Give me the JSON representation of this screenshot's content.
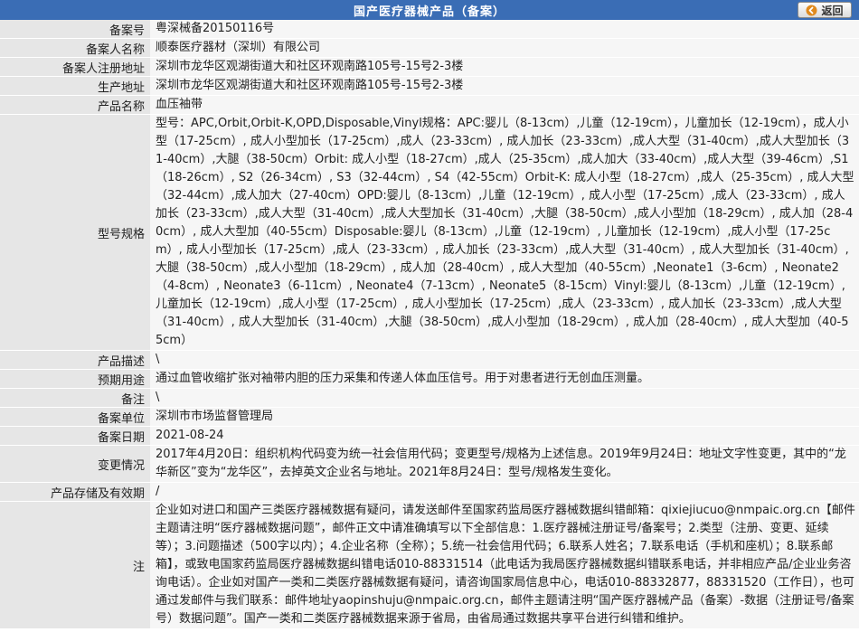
{
  "header": {
    "title": "国产医疗器械产品（备案）",
    "back_label": "返回"
  },
  "rows": [
    {
      "label": "备案号",
      "value": "粤深械备20150116号"
    },
    {
      "label": "备案人名称",
      "value": "顺泰医疗器材（深圳）有限公司"
    },
    {
      "label": "备案人注册地址",
      "value": "深圳市龙华区观湖街道大和社区环观南路105号-15号2-3楼"
    },
    {
      "label": "生产地址",
      "value": "深圳市龙华区观湖街道大和社区环观南路105号-15号2-3楼"
    },
    {
      "label": "产品名称",
      "value": "血压袖带"
    },
    {
      "label": "型号规格",
      "value": "型号：APC,Orbit,Orbit-K,OPD,Disposable,Vinyl规格：APC:婴儿（8-13cm）,儿童（12-19cm），儿童加长（12-19cm），成人小型（17-25cm）, 成人小型加长（17-25cm）,成人（23-33cm）, 成人加长（23-33cm）,成人大型（31-40cm）,成人大型加长（31-40cm）,大腿（38-50cm）Orbit: 成人小型（18-27cm）,成人（25-35cm）,成人加大（33-40cm）,成人大型（39-46cm）,S1（18-26cm）, S2（26-34cm）, S3（32-44cm）, S4（42-55cm）Orbit-K: 成人小型（18-27cm）,成人（25-35cm）, 成人大型（32-44cm）,成人加大（27-40cm）OPD:婴儿（8-13cm）,儿童（12-19cm）, 成人小型（17-25cm）,成人（23-33cm）, 成人加长（23-33cm）,成人大型（31-40cm）,成人大型加长（31-40cm）,大腿（38-50cm）,成人小型加（18-29cm）, 成人加（28-40cm）, 成人大型加（40-55cm）Disposable:婴儿（8-13cm）,儿童（12-19cm）, 儿童加长（12-19cm）,成人小型（17-25cm）, 成人小型加长（17-25cm）,成人（23-33cm）, 成人加长（23-33cm）,成人大型（31-40cm）, 成人大型加长（31-40cm）,大腿（38-50cm）,成人小型加（18-29cm）, 成人加（28-40cm）, 成人大型加（40-55cm）,Neonate1（3-6cm）, Neonate2（4-8cm）, Neonate3（6-11cm）, Neonate4（7-13cm）, Neonate5（8-15cm）Vinyl:婴儿（8-13cm）,儿童（12-19cm）, 儿童加长（12-19cm）,成人小型（17-25cm）, 成人小型加长（17-25cm）,成人（23-33cm）, 成人加长（23-33cm）,成人大型（31-40cm）, 成人大型加长（31-40cm）,大腿（38-50cm）,成人小型加（18-29cm）, 成人加（28-40cm）, 成人大型加（40-55cm）"
    },
    {
      "label": "产品描述",
      "value": "\\"
    },
    {
      "label": "预期用途",
      "value": "通过血管收缩扩张对袖带内胆的压力采集和传递人体血压信号。用于对患者进行无创血压测量。"
    },
    {
      "label": "备注",
      "value": "\\"
    },
    {
      "label": "备案单位",
      "value": "深圳市市场监督管理局"
    },
    {
      "label": "备案日期",
      "value": "2021-08-24"
    },
    {
      "label": "变更情况",
      "value": "2017年4月20日：组织机构代码变为统一社会信用代码；变更型号/规格为上述信息。2019年9月24日：地址文字性变更，其中的“龙华新区”变为“龙华区”，去掉英文企业名与地址。2021年8月24日：型号/规格发生变化。"
    },
    {
      "label": "产品存储及有效期",
      "value": "/"
    },
    {
      "label": "注",
      "value": "企业如对进口和国产三类医疗器械数据有疑问，请发送邮件至国家药监局医疗器械数据纠错邮箱：qixiejiucuo@nmpaic.org.cn【邮件主题请注明“医疗器械数据问题”，邮件正文中请准确填写以下全部信息：1.医疗器械注册证号/备案号；2.类型（注册、变更、延续等）；3.问题描述（500字以内）；4.企业名称（全称）；5.统一社会信用代码；6.联系人姓名；7.联系电话（手机和座机）；8.联系邮箱】，或致电国家药监局医疗器械数据纠错电话010-88331514（此电话为我局医疗器械数据纠错联系电话，并非相应产品/企业业务咨询电话）。企业如对国产一类和二类医疗器械数据有疑问，请咨询国家局信息中心，电话010-88332877，88331520（工作日），也可通过发邮件与我们联系：邮件地址yaopinshuju@nmpaic.org.cn，邮件主题请注明“国产医疗器械产品（备案）-数据（注册证号/备案号）数据问题”。国产一类和二类医疗器械数据来源于省局，由省局通过数据共享平台进行纠错和维护。"
    }
  ],
  "colors": {
    "header_bg": "#3a6db5",
    "label_bg": "#e6e6e6",
    "value_bg": "#f6f6f6",
    "arrow_icon": "#e08a1e"
  }
}
